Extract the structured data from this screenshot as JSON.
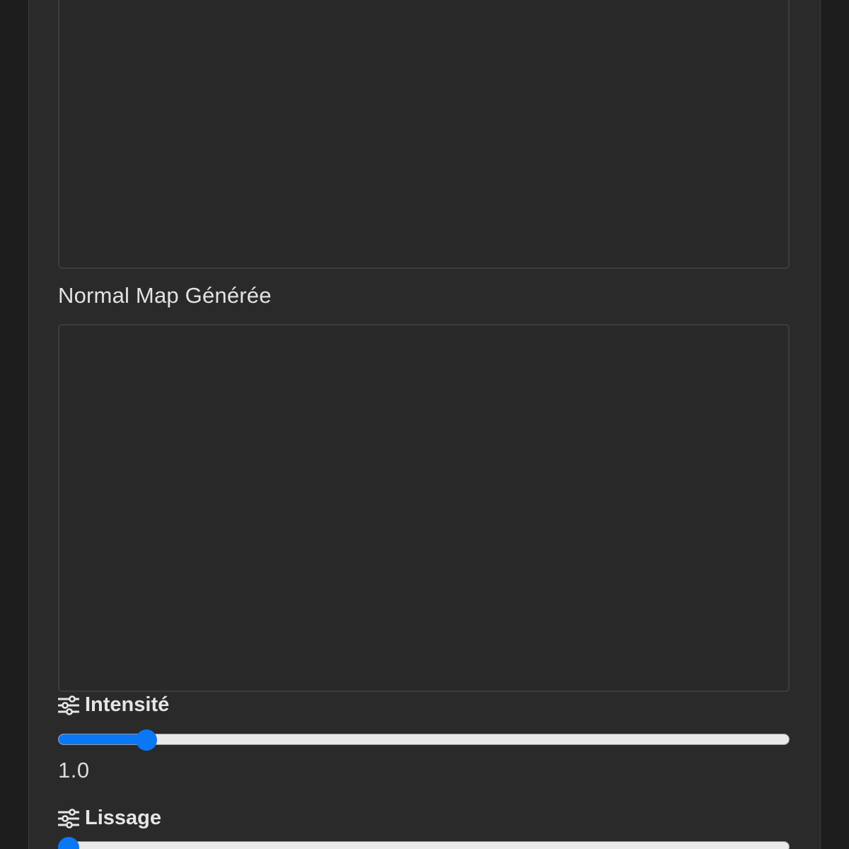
{
  "app": {
    "normal_map_label": "Normal Map Générée"
  },
  "sliders": {
    "intensite": {
      "label": "Intensité",
      "value_text": "1.0",
      "fraction": 0.11
    },
    "lissage": {
      "label": "Lissage",
      "fraction": 0.0
    }
  },
  "colors": {
    "accent": "#0a78f5",
    "panel_bg": "#2a2a2a",
    "page_bg": "#1d1d1d"
  },
  "icons": {
    "slider_label_icon": "sliders-icon"
  }
}
